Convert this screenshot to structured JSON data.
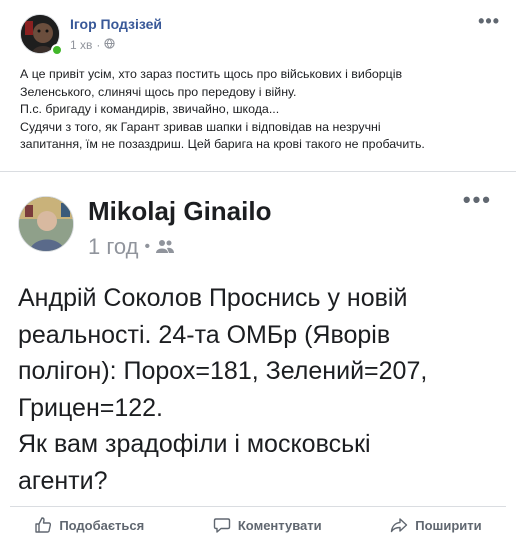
{
  "post": {
    "author": "Ігор Подзізей",
    "time": "1 хв",
    "separator": "·",
    "more_icon": "more-dots-icon",
    "privacy_icon": "globe-icon",
    "text_lines": [
      "А це привіт усім, хто зараз постить щось про військових і виборців",
      "Зеленського, слинячі щось про передову і війну.",
      "П.с. бригаду і командирів, звичайно, шкода...",
      "Судячи з того, як Гарант зривав шапки і відповідав на незручні",
      "запитання, їм не позаздриш. Цей барига на крові такого не пробачить."
    ]
  },
  "shared_post": {
    "author": "Mikolaj Ginailo",
    "time": "1 год",
    "separator": "•",
    "audience_icon": "friends-icon",
    "text_lines": [
      "Андрій Соколов  Проснись у новій",
      "реальності. 24-та ОМБр (Яворів",
      "полігон): Порох=181, Зелений=207,",
      "Грицен=122.",
      "Як вам зрадофіли і московські",
      "агенти?"
    ]
  },
  "actions": {
    "like": "Подобається",
    "comment": "Коментувати",
    "share": "Поширити"
  },
  "colors": {
    "link": "#385898",
    "meta": "#90949c",
    "online": "#42b72a",
    "action": "#606770"
  }
}
